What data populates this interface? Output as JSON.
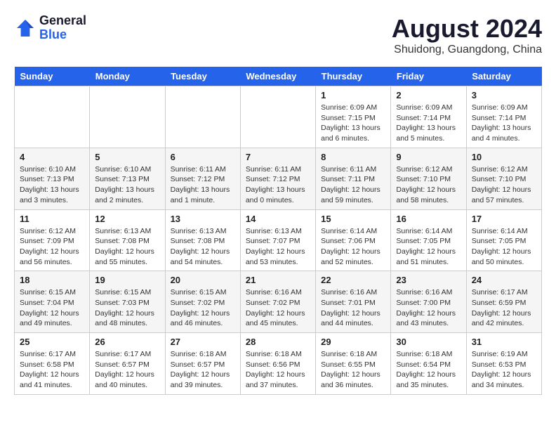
{
  "logo": {
    "line1": "General",
    "line2": "Blue"
  },
  "title": "August 2024",
  "location": "Shuidong, Guangdong, China",
  "weekdays": [
    "Sunday",
    "Monday",
    "Tuesday",
    "Wednesday",
    "Thursday",
    "Friday",
    "Saturday"
  ],
  "weeks": [
    [
      {
        "day": "",
        "info": ""
      },
      {
        "day": "",
        "info": ""
      },
      {
        "day": "",
        "info": ""
      },
      {
        "day": "",
        "info": ""
      },
      {
        "day": "1",
        "info": "Sunrise: 6:09 AM\nSunset: 7:15 PM\nDaylight: 13 hours\nand 6 minutes."
      },
      {
        "day": "2",
        "info": "Sunrise: 6:09 AM\nSunset: 7:14 PM\nDaylight: 13 hours\nand 5 minutes."
      },
      {
        "day": "3",
        "info": "Sunrise: 6:09 AM\nSunset: 7:14 PM\nDaylight: 13 hours\nand 4 minutes."
      }
    ],
    [
      {
        "day": "4",
        "info": "Sunrise: 6:10 AM\nSunset: 7:13 PM\nDaylight: 13 hours\nand 3 minutes."
      },
      {
        "day": "5",
        "info": "Sunrise: 6:10 AM\nSunset: 7:13 PM\nDaylight: 13 hours\nand 2 minutes."
      },
      {
        "day": "6",
        "info": "Sunrise: 6:11 AM\nSunset: 7:12 PM\nDaylight: 13 hours\nand 1 minute."
      },
      {
        "day": "7",
        "info": "Sunrise: 6:11 AM\nSunset: 7:12 PM\nDaylight: 13 hours\nand 0 minutes."
      },
      {
        "day": "8",
        "info": "Sunrise: 6:11 AM\nSunset: 7:11 PM\nDaylight: 12 hours\nand 59 minutes."
      },
      {
        "day": "9",
        "info": "Sunrise: 6:12 AM\nSunset: 7:10 PM\nDaylight: 12 hours\nand 58 minutes."
      },
      {
        "day": "10",
        "info": "Sunrise: 6:12 AM\nSunset: 7:10 PM\nDaylight: 12 hours\nand 57 minutes."
      }
    ],
    [
      {
        "day": "11",
        "info": "Sunrise: 6:12 AM\nSunset: 7:09 PM\nDaylight: 12 hours\nand 56 minutes."
      },
      {
        "day": "12",
        "info": "Sunrise: 6:13 AM\nSunset: 7:08 PM\nDaylight: 12 hours\nand 55 minutes."
      },
      {
        "day": "13",
        "info": "Sunrise: 6:13 AM\nSunset: 7:08 PM\nDaylight: 12 hours\nand 54 minutes."
      },
      {
        "day": "14",
        "info": "Sunrise: 6:13 AM\nSunset: 7:07 PM\nDaylight: 12 hours\nand 53 minutes."
      },
      {
        "day": "15",
        "info": "Sunrise: 6:14 AM\nSunset: 7:06 PM\nDaylight: 12 hours\nand 52 minutes."
      },
      {
        "day": "16",
        "info": "Sunrise: 6:14 AM\nSunset: 7:05 PM\nDaylight: 12 hours\nand 51 minutes."
      },
      {
        "day": "17",
        "info": "Sunrise: 6:14 AM\nSunset: 7:05 PM\nDaylight: 12 hours\nand 50 minutes."
      }
    ],
    [
      {
        "day": "18",
        "info": "Sunrise: 6:15 AM\nSunset: 7:04 PM\nDaylight: 12 hours\nand 49 minutes."
      },
      {
        "day": "19",
        "info": "Sunrise: 6:15 AM\nSunset: 7:03 PM\nDaylight: 12 hours\nand 48 minutes."
      },
      {
        "day": "20",
        "info": "Sunrise: 6:15 AM\nSunset: 7:02 PM\nDaylight: 12 hours\nand 46 minutes."
      },
      {
        "day": "21",
        "info": "Sunrise: 6:16 AM\nSunset: 7:02 PM\nDaylight: 12 hours\nand 45 minutes."
      },
      {
        "day": "22",
        "info": "Sunrise: 6:16 AM\nSunset: 7:01 PM\nDaylight: 12 hours\nand 44 minutes."
      },
      {
        "day": "23",
        "info": "Sunrise: 6:16 AM\nSunset: 7:00 PM\nDaylight: 12 hours\nand 43 minutes."
      },
      {
        "day": "24",
        "info": "Sunrise: 6:17 AM\nSunset: 6:59 PM\nDaylight: 12 hours\nand 42 minutes."
      }
    ],
    [
      {
        "day": "25",
        "info": "Sunrise: 6:17 AM\nSunset: 6:58 PM\nDaylight: 12 hours\nand 41 minutes."
      },
      {
        "day": "26",
        "info": "Sunrise: 6:17 AM\nSunset: 6:57 PM\nDaylight: 12 hours\nand 40 minutes."
      },
      {
        "day": "27",
        "info": "Sunrise: 6:18 AM\nSunset: 6:57 PM\nDaylight: 12 hours\nand 39 minutes."
      },
      {
        "day": "28",
        "info": "Sunrise: 6:18 AM\nSunset: 6:56 PM\nDaylight: 12 hours\nand 37 minutes."
      },
      {
        "day": "29",
        "info": "Sunrise: 6:18 AM\nSunset: 6:55 PM\nDaylight: 12 hours\nand 36 minutes."
      },
      {
        "day": "30",
        "info": "Sunrise: 6:18 AM\nSunset: 6:54 PM\nDaylight: 12 hours\nand 35 minutes."
      },
      {
        "day": "31",
        "info": "Sunrise: 6:19 AM\nSunset: 6:53 PM\nDaylight: 12 hours\nand 34 minutes."
      }
    ]
  ]
}
